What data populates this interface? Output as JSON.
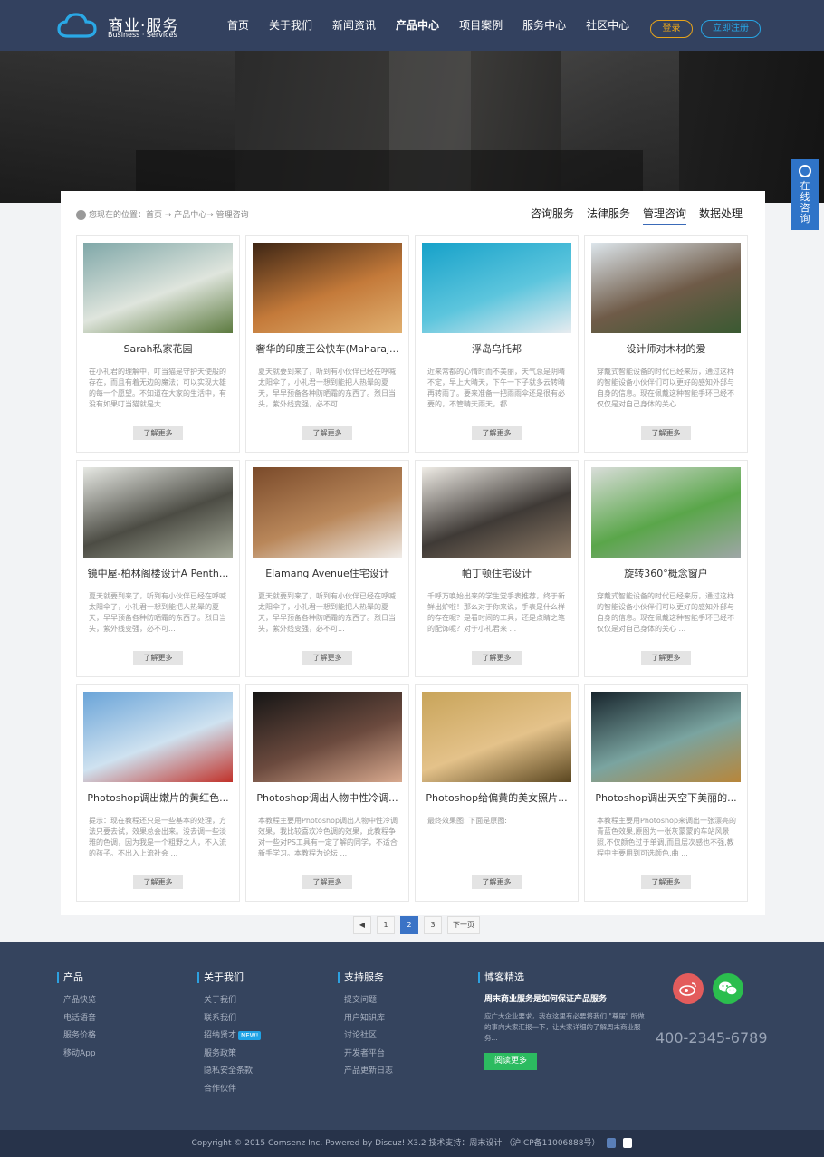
{
  "header": {
    "logo_title": "商业·服务",
    "logo_sub": "Business · Services",
    "nav": [
      "首页",
      "关于我们",
      "新闻资讯",
      "产品中心",
      "项目案例",
      "服务中心",
      "社区中心"
    ],
    "nav_active_index": 3,
    "login": "登录",
    "register": "立即注册"
  },
  "consult": "在线咨询",
  "breadcrumb": "您现在的位置：首页 → 产品中心→ 管理咨询",
  "subnav": [
    "咨询服务",
    "法律服务",
    "管理咨询",
    "数据处理"
  ],
  "subnav_active_index": 2,
  "more_label": "了解更多",
  "cards": [
    {
      "title": "Sarah私家花园",
      "desc": "在小礼君的理解中，叮当猫是守护天使般的存在，而且有着无边的魔法；可以实现大雄的每一个愿望。不知道在大家的生活中，有没有如果叮当猫就是大...",
      "colors": [
        "#7fa7a8",
        "#dfe5dd",
        "#5c7a3f"
      ]
    },
    {
      "title": "奢华的印度王公快车(Maharaj...",
      "desc": "夏天就要到来了，听到有小伙伴已经在呼喊太阳伞了，小礼君一想到能把人热晕的夏天，早早预备各种防晒霜的东西了。烈日当头，紫外线变强，必不可...",
      "colors": [
        "#3d2514",
        "#c47a3a",
        "#e1b070"
      ]
    },
    {
      "title": "浮岛乌托邦",
      "desc": "近来常都的心情时而不美丽，天气总是阴晴不定，早上大晴天，下午一下子就多云转晴再转雨了。要来准备一把雨雨伞还是很有必要的，不管晴天雨天，都...",
      "colors": [
        "#16a1c9",
        "#5cc5dd",
        "#e8ecf0"
      ]
    },
    {
      "title": "设计师对木材的爱",
      "desc": "穿戴式智能设备的时代已经来历，通过这样的智能设备小伙伴们可以更好的感知外部与自身的信息。现在佩戴这种智能手环已经不仅仅是对自己身体的关心 ...",
      "colors": [
        "#dde6ec",
        "#6f5b48",
        "#3a5a32"
      ]
    },
    {
      "title": "镜中屋-柏林阁楼设计A Penth...",
      "desc": "夏天就要到来了，听到有小伙伴已经在呼喊太阳伞了，小礼君一想到能把人热晕的夏天，早早预备各种防晒霜的东西了。烈日当头，紫外线变强，必不可...",
      "colors": [
        "#e7e9e4",
        "#4c4c44",
        "#a3a897"
      ]
    },
    {
      "title": "Elamang Avenue住宅设计",
      "desc": "夏天就要到来了，听到有小伙伴已经在呼喊太阳伞了，小礼君一想到能把人热晕的夏天，早早预备各种防晒霜的东西了。烈日当头，紫外线变强，必不可...",
      "colors": [
        "#7a4a2a",
        "#b9875a",
        "#f0ece8"
      ]
    },
    {
      "title": "帕丁顿住宅设计",
      "desc": "千呼万唤始出来的学生党手表推荐，终于新鲜出炉啦！那么对于你来说，手表是什么样的存在呢？是看时间的工具，还是点睛之笔的配饰呢？对于小礼君来 ...",
      "colors": [
        "#efece6",
        "#3f3a36",
        "#8d7a66"
      ]
    },
    {
      "title": "旋转360°概念窗户",
      "desc": "穿戴式智能设备的时代已经来历，通过这样的智能设备小伙伴们可以更好的感知外部与自身的信息。现在佩戴这种智能手环已经不仅仅是对自己身体的关心 ...",
      "colors": [
        "#d9ddd9",
        "#5aa64a",
        "#9ea6a6"
      ]
    },
    {
      "title": "Photoshop调出嫩片的黄红色...",
      "desc": "提示：现在教程还只是一些基本的处理，方法只要去试，效果总会出来。没去调一些淡雅的色调，因为我是一个粗野之人，不入流的孩子。不出入上流社会 ...",
      "colors": [
        "#6aa4d8",
        "#cfe2f0",
        "#c1322a"
      ]
    },
    {
      "title": "Photoshop调出人物中性冷调...",
      "desc": "本教程主要用Photoshop调出人物中性冷调效果，我比较喜欢冷色调的效果，此教程争对一些对PS工具有一定了解的同学，不适合新手学习。本教程为论坛 ...",
      "colors": [
        "#151515",
        "#6b4a3e",
        "#d8a98e"
      ]
    },
    {
      "title": "Photoshop给偏黄的美女照片...",
      "desc": "最终效果图: 下面是原图:",
      "colors": [
        "#c8a45a",
        "#e4c28a",
        "#5a4620"
      ]
    },
    {
      "title": "Photoshop调出天空下美丽的...",
      "desc": "本教程主要用Photoshop来调出一张漂亮的青蓝色效果,原图为一张灰蒙蒙的车站风景照,不仅颜色过于单调,而且层次感也不强,教程中主要用到可选颜色,曲 ...",
      "colors": [
        "#17242c",
        "#7aa4a0",
        "#b8863a"
      ]
    }
  ],
  "pagination": {
    "prev": "◀",
    "pages": [
      "1",
      "2",
      "3"
    ],
    "active": "2",
    "next": "下一页"
  },
  "footer": {
    "col1": {
      "title": "产品",
      "items": [
        "产品快览",
        "电话语音",
        "服务价格",
        "移动App"
      ]
    },
    "col2": {
      "title": "关于我们",
      "items": [
        "关于我们",
        "联系我们",
        "招纳贤才",
        "服务政策",
        "隐私安全条款",
        "合作伙伴"
      ],
      "new_badge": "NEW!"
    },
    "col3": {
      "title": "支持服务",
      "items": [
        "提交问题",
        "用户知识库",
        "讨论社区",
        "开发者平台",
        "产品更新日志"
      ]
    },
    "blog": {
      "title": "博客精选",
      "post_title": "周末商业服务是如何保证产品服务",
      "post_desc": "应广大企业要求，我在这里有必要将我们 \"尊居\" 所做的事向大家汇报一下，让大家详细的了解周末商业服务...",
      "more": "阅读更多"
    },
    "phone": "400-2345-6789",
    "copyright": "Copyright © 2015  Comsenz Inc.  Powered by  Discuz!  X3.2  技术支持：周末设计  （沪ICP备11006888号）"
  },
  "colors": {
    "header_bg": "#33415f",
    "footer_bg": "#35445e",
    "accent_blue": "#3a73c6",
    "login_orange": "#e8a41a",
    "green": "#2cbb60"
  }
}
